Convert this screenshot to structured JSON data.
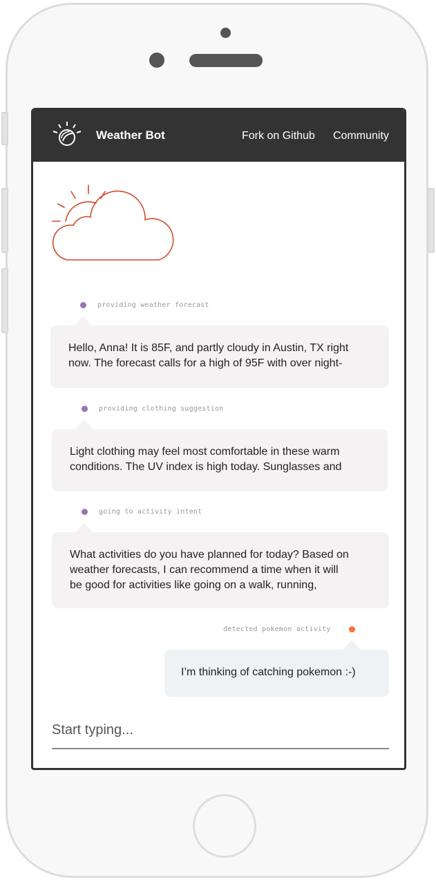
{
  "app": {
    "title": "Weather Bot",
    "nav": [
      {
        "label": "Fork on Github"
      },
      {
        "label": "Community"
      }
    ]
  },
  "colors": {
    "topbar": "#333333",
    "bot_dot": "#9c73b8",
    "user_dot": "#f0743a",
    "bot_bubble": "#f4f2f2",
    "user_bubble": "#eef2f4",
    "illustration_stroke": "#d3472a"
  },
  "icons": {
    "logo": "watson-logo-icon",
    "illustration": "partly-cloudy-icon"
  },
  "messages": [
    {
      "sender": "bot",
      "intent": "providing weather forecast",
      "lines": [
        "Hello, Anna! It is 85F, and partly cloudy in Austin, TX right",
        "now. The forecast calls for a high of 95F with over night-"
      ]
    },
    {
      "sender": "bot",
      "intent": "providing clothing suggestion",
      "lines": [
        "Light clothing may feel most comfortable in these warm",
        "conditions. The UV index is high today. Sunglasses and"
      ]
    },
    {
      "sender": "bot",
      "intent": "going to activity intent",
      "lines": [
        "What activities do you have planned for today? Based on",
        "weather forecasts, I can recommend a time when it will",
        "be good for activities like going on a walk, running,"
      ]
    },
    {
      "sender": "user",
      "intent": "detected pokemon activity",
      "lines": [
        "I’m thinking of catching pokemon :-)"
      ]
    }
  ],
  "input": {
    "placeholder": "Start typing..."
  }
}
